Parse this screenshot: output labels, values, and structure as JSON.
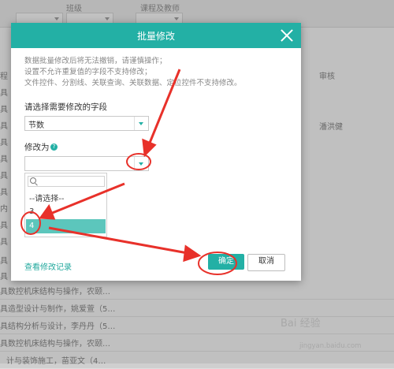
{
  "background": {
    "header_tabs": [
      "班级",
      "课程及教师"
    ],
    "row_prefixes": [
      "程",
      "具",
      "具",
      "具",
      "具",
      "具",
      "具",
      "具",
      "具",
      "具",
      "具",
      "具",
      "具",
      "内",
      "具",
      "具"
    ],
    "right_col_header": "审核",
    "right_col_value": "潘洪健",
    "rows": [
      "具数控机床结构与操作，农颐…",
      "具造型设计与制作，姚爱萱（5…",
      "具结构分析与设计，李丹丹（5…",
      "具数控机床结构与操作，农颐…",
      "计与装饰施工，苗亚文（4…"
    ]
  },
  "modal": {
    "title": "批量修改",
    "notice": [
      "数据批量修改后将无法撤销，请谨慎操作；",
      "设置不允许重复值的字段不支持修改；",
      "文件控件、分割线、关联查询、关联数据、定位控件不支持修改。"
    ],
    "field_label": "请选择需要修改的字段",
    "field_value": "节数",
    "modify_label": "修改为",
    "modify_value": "",
    "dropdown": {
      "search_placeholder": "",
      "options": [
        "--请选择--",
        "3",
        "4"
      ],
      "selected": "4"
    },
    "history_link": "查看修改记录",
    "ok_label": "确定",
    "cancel_label": "取消"
  },
  "colors": {
    "accent": "#23b0a5",
    "annotation": "#e8312a"
  },
  "watermark": {
    "main": "Bai 经验",
    "sub": "jingyan.baidu.com"
  }
}
